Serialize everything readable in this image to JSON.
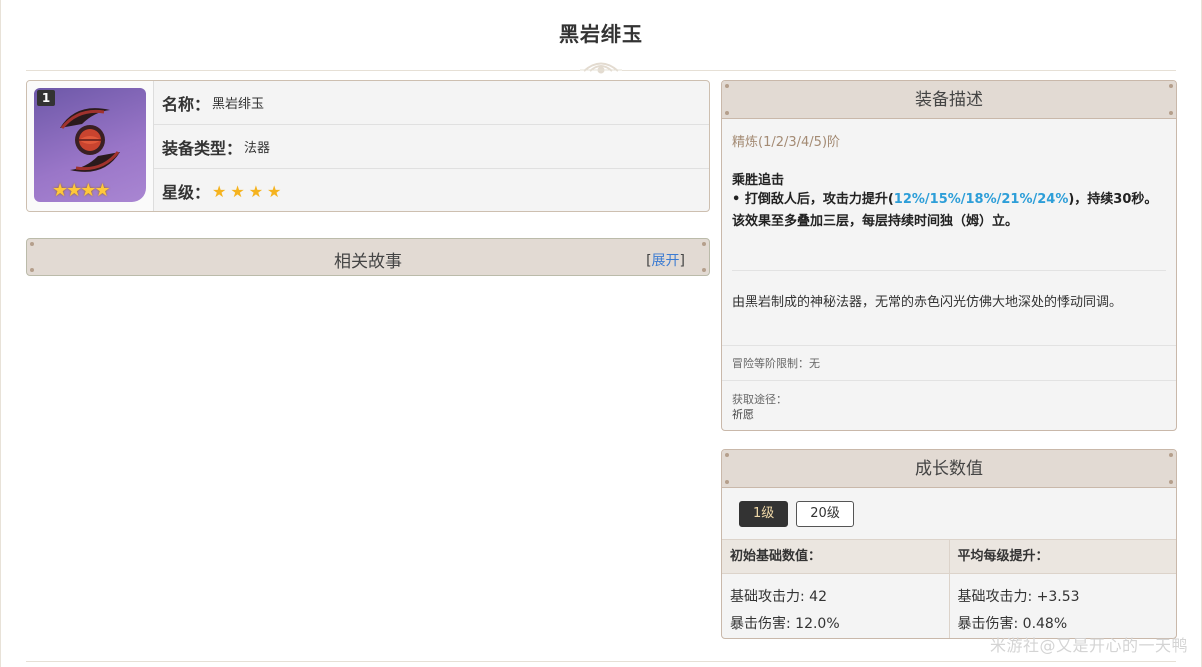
{
  "page": {
    "title": "黑岩绯玉"
  },
  "info": {
    "avatar": {
      "level_badge": "1",
      "stars_display": "★★★★"
    },
    "name_label": "名称：",
    "name_value": "黑岩绯玉",
    "type_label": "装备类型：",
    "type_value": "法器",
    "rarity_label": "星级：",
    "rarity_stars": 4
  },
  "story": {
    "title": "相关故事",
    "expand_open": "[",
    "expand_link": "展开",
    "expand_close": "]"
  },
  "description": {
    "title": "装备描述",
    "refinement": "精炼(1/2/3/4/5)阶",
    "skill_name": "乘胜追击",
    "skill_prefix": "• 打倒敌人后，攻击力提升(",
    "skill_values": "12%/15%/18%/21%/24%",
    "skill_suffix": ")，持续30秒。该效果至多叠加三层，每层持续时间独（姆）立。",
    "flavor": "由黑岩制成的神秘法器，无常的赤色闪光仿佛大地深处的悸动同调。",
    "level_limit": "冒险等阶限制：无",
    "source_label": "获取途径：",
    "source_value": "祈愿"
  },
  "growth": {
    "title": "成长数值",
    "tabs": [
      {
        "label": "1级",
        "active": true
      },
      {
        "label": "20级",
        "active": false
      }
    ],
    "headers": [
      "初始基础数值：",
      "平均每级提升："
    ],
    "base": [
      "基础攻击力: 42",
      "暴击伤害: 12.0%"
    ],
    "per_level": [
      "基础攻击力: +3.53",
      "暴击伤害: 0.48%"
    ]
  },
  "watermark": "米游社@又是开心的一天鸭",
  "colors": {
    "header_bg": "#e2dad3",
    "panel_bg": "#f4f4f4",
    "border": "#c9b8aa",
    "star": "#f5b31f",
    "highlight": "#2d9ed8",
    "refine_text": "#a48b74",
    "link": "#3b7bd2"
  }
}
